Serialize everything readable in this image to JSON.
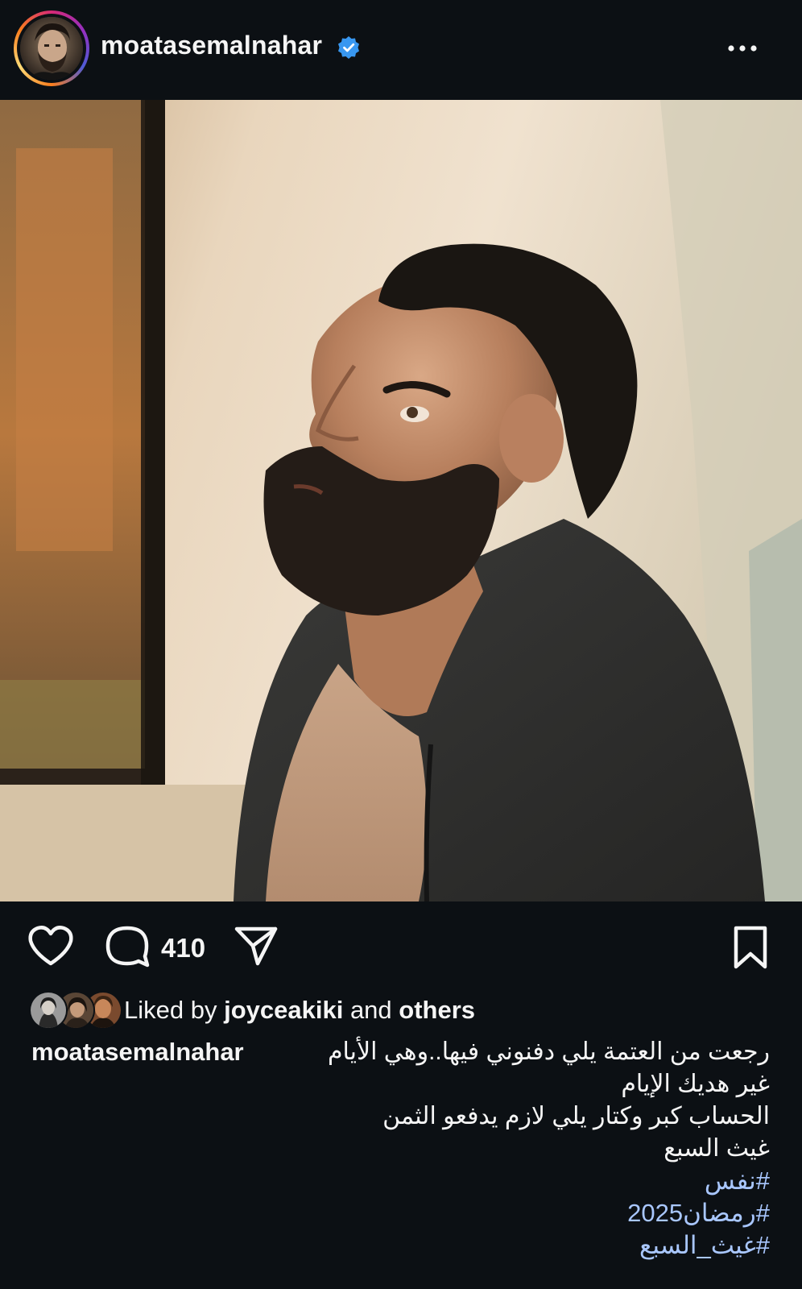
{
  "header": {
    "username": "moatasemalnahar",
    "verified_icon": "verified-badge-icon",
    "more_icon": "more-options-icon",
    "colors": {
      "background": "#0c1014",
      "verified": "#3897f0"
    }
  },
  "post": {
    "image_alt": "Portrait of a bearded man in a dark hoodie looking upward, leaning against a wall"
  },
  "actions": {
    "like_icon": "heart-icon",
    "comment_icon": "comment-icon",
    "comment_count": "410",
    "share_icon": "send-icon",
    "save_icon": "bookmark-icon"
  },
  "likes": {
    "prefix": "Liked by",
    "user": "joyceakiki",
    "connector": "and",
    "suffix": "others"
  },
  "caption": {
    "username": "moatasemalnahar",
    "lines": [
      "رجعت من العتمة يلي دفنوني فيها..وهي الأيام",
      "غير هديك الإيام",
      "الحساب كبر وكتار يلي لازم يدفعو الثمن",
      "غيث السبع"
    ],
    "hashtags": [
      "#نفس",
      "#رمضان2025",
      "#غيث_السبع"
    ],
    "colors": {
      "hashtag": "#a9c7ff"
    }
  }
}
